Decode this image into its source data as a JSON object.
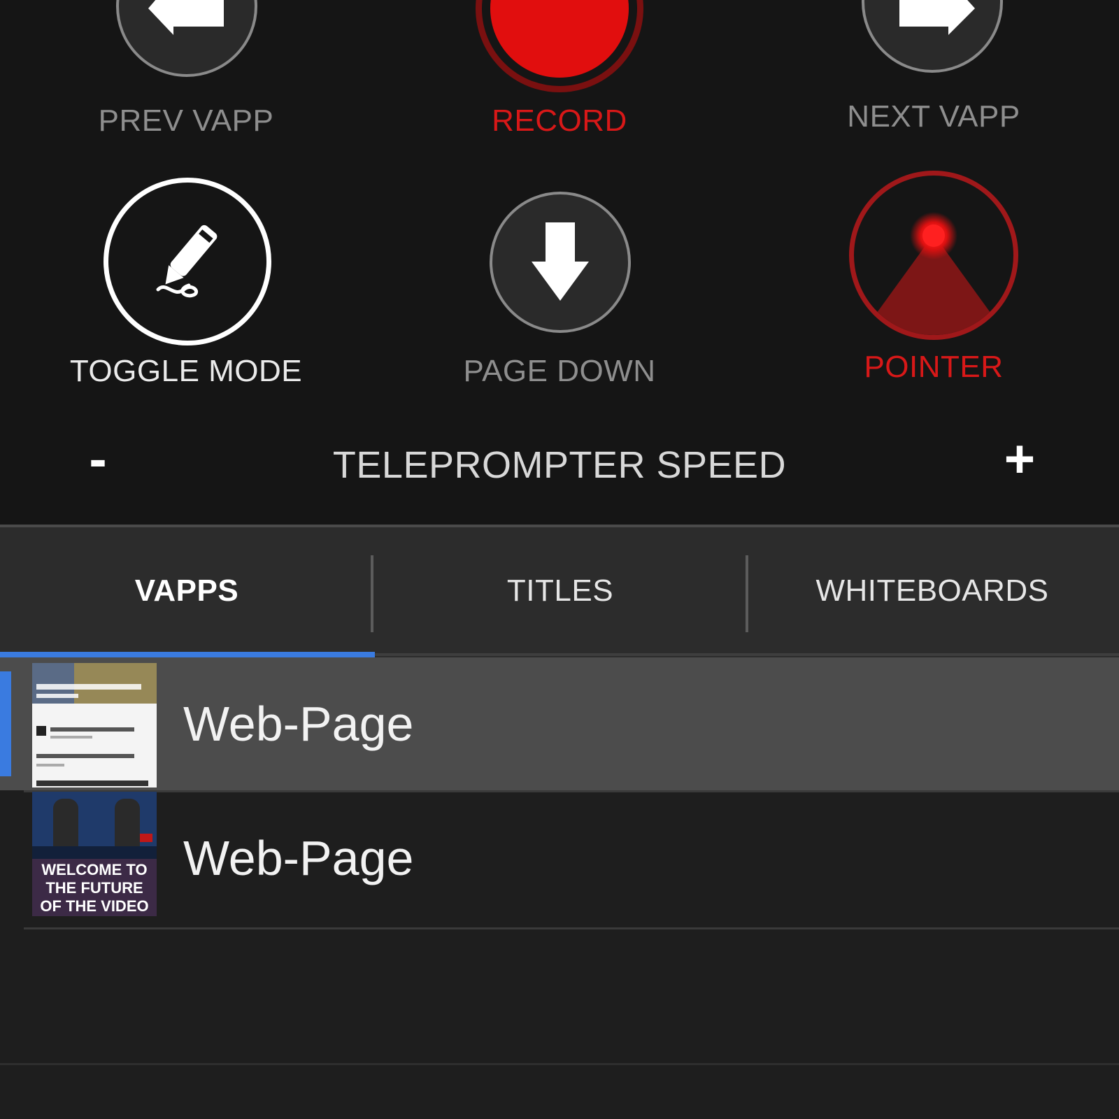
{
  "controls": {
    "prev": {
      "label": "PREV VAPP",
      "icon": "arrow-left-icon"
    },
    "record": {
      "label": "RECORD",
      "icon": "record-icon"
    },
    "next": {
      "label": "NEXT VAPP",
      "icon": "arrow-right-icon"
    },
    "toggle": {
      "label": "TOGGLE MODE",
      "icon": "pen-icon"
    },
    "pagedown": {
      "label": "PAGE DOWN",
      "icon": "arrow-down-icon"
    },
    "pointer": {
      "label": "POINTER",
      "icon": "laser-pointer-icon"
    }
  },
  "speed": {
    "minus": "-",
    "label": "TELEPROMPTER SPEED",
    "plus": "+"
  },
  "tabs": [
    {
      "label": "VAPPS",
      "active": true
    },
    {
      "label": "TITLES",
      "active": false
    },
    {
      "label": "WHITEBOARDS",
      "active": false
    }
  ],
  "list": {
    "items": [
      {
        "title": "Web-Page",
        "selected": true
      },
      {
        "title": "Web-Page",
        "selected": false,
        "thumb_text": [
          "WELCOME TO",
          "THE FUTURE",
          "OF THE VIDEO"
        ]
      }
    ]
  },
  "colors": {
    "accent_blue": "#3a7be0",
    "record_red": "#e10e0e",
    "label_red": "#d81818",
    "background": "#161616"
  }
}
